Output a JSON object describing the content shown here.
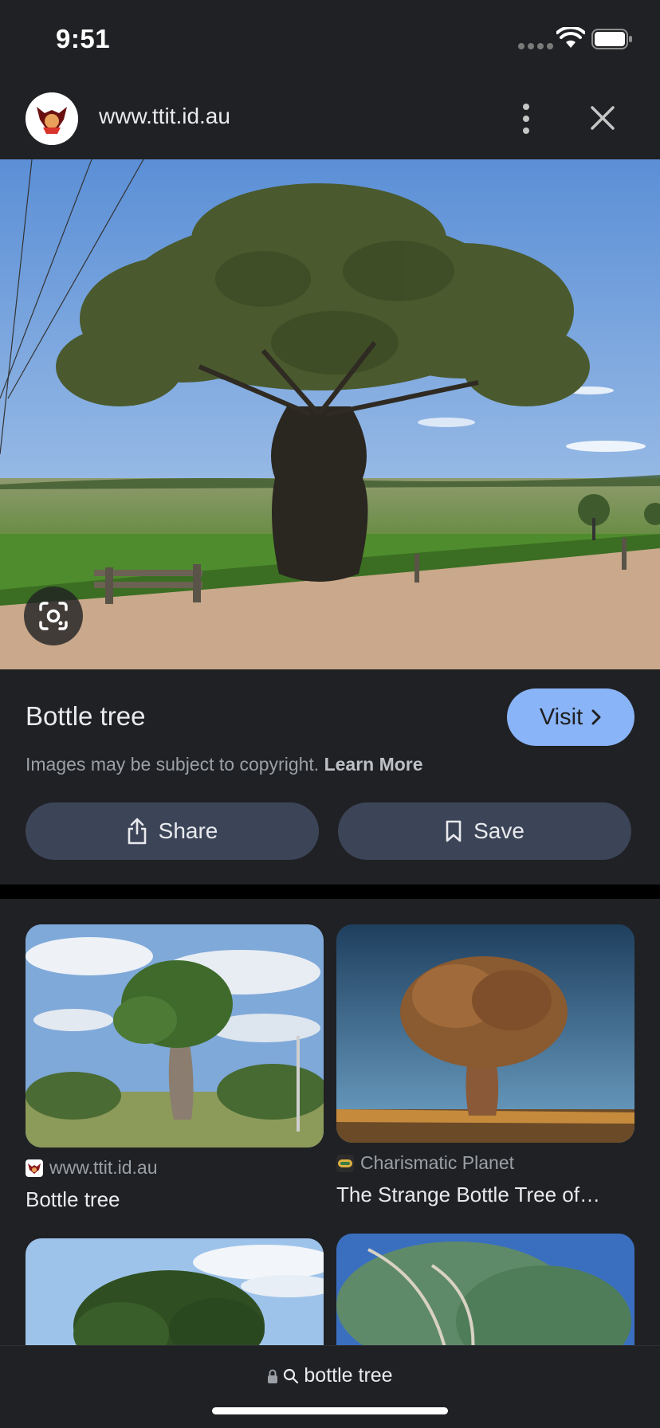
{
  "status_bar": {
    "time": "9:51"
  },
  "header": {
    "url": "www.ttit.id.au"
  },
  "image": {
    "title": "Bottle tree",
    "visit_label": "Visit",
    "copyright_text": "Images may be subject to copyright.",
    "learn_more_label": "Learn More",
    "share_label": "Share",
    "save_label": "Save"
  },
  "related": [
    {
      "source": "www.ttit.id.au",
      "title": "Bottle tree"
    },
    {
      "source": "Charismatic Planet",
      "title": "The Strange Bottle Tree of…"
    }
  ],
  "search": {
    "query": "bottle tree"
  },
  "colors": {
    "accent": "#8ab4f8",
    "background": "#202124",
    "pill": "#3c4458"
  }
}
